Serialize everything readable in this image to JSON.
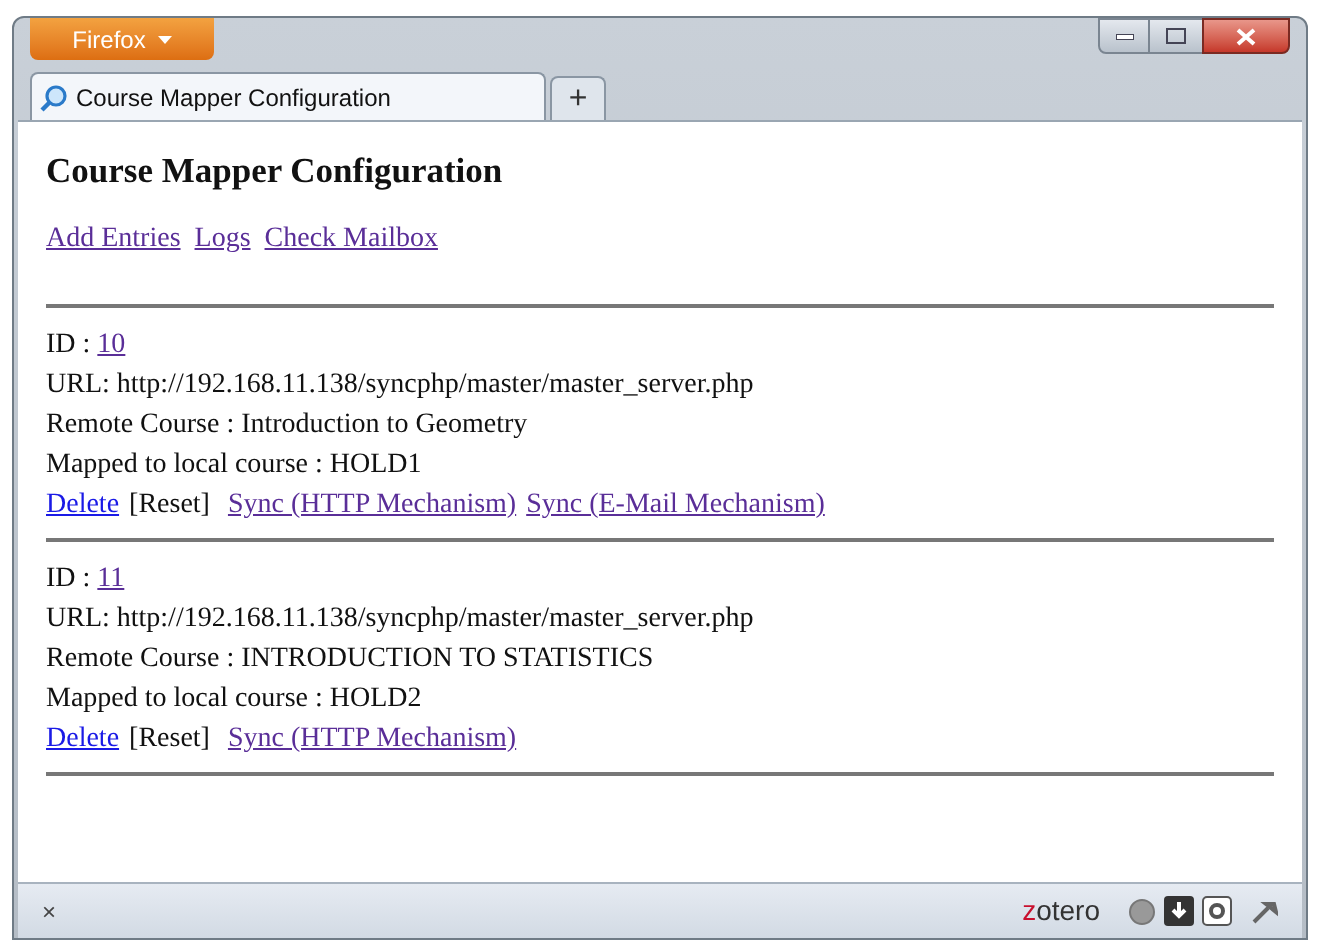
{
  "browser": {
    "menu_button": "Firefox",
    "tabs": [
      {
        "label": "Course Mapper Configuration",
        "selected": true
      }
    ],
    "new_tab": "+"
  },
  "page": {
    "heading": "Course Mapper Configuration",
    "nav_links": [
      {
        "label": "Add Entries",
        "visited": true
      },
      {
        "label": "Logs",
        "visited": true
      },
      {
        "label": "Check Mailbox",
        "visited": true
      }
    ],
    "entries": [
      {
        "id_label": "ID : ",
        "id": "10",
        "id_visited": true,
        "lines": [
          "URL: http://192.168.11.138/syncphp/master/master_server.php",
          "Remote Course : Introduction to Geometry",
          "Mapped to local course : HOLD1"
        ],
        "actions": [
          {
            "kind": "link",
            "label": "Delete",
            "visited": false
          },
          {
            "kind": "text",
            "label": "[Reset]"
          },
          {
            "kind": "link",
            "label": "Sync (HTTP Mechanism)",
            "visited": true
          },
          {
            "kind": "link",
            "label": "Sync (E-Mail Mechanism)",
            "visited": true
          }
        ]
      },
      {
        "id_label": "ID : ",
        "id": "11",
        "id_visited": true,
        "lines": [
          "URL: http://192.168.11.138/syncphp/master/master_server.php",
          "Remote Course : INTRODUCTION TO STATISTICS",
          "Mapped to local course : HOLD2"
        ],
        "actions": [
          {
            "kind": "link",
            "label": "Delete",
            "visited": false
          },
          {
            "kind": "text",
            "label": "[Reset]"
          },
          {
            "kind": "link",
            "label": "Sync (HTTP Mechanism)",
            "visited": true
          }
        ]
      }
    ]
  },
  "status_bar": {
    "close": "×",
    "addon": "zotero"
  }
}
